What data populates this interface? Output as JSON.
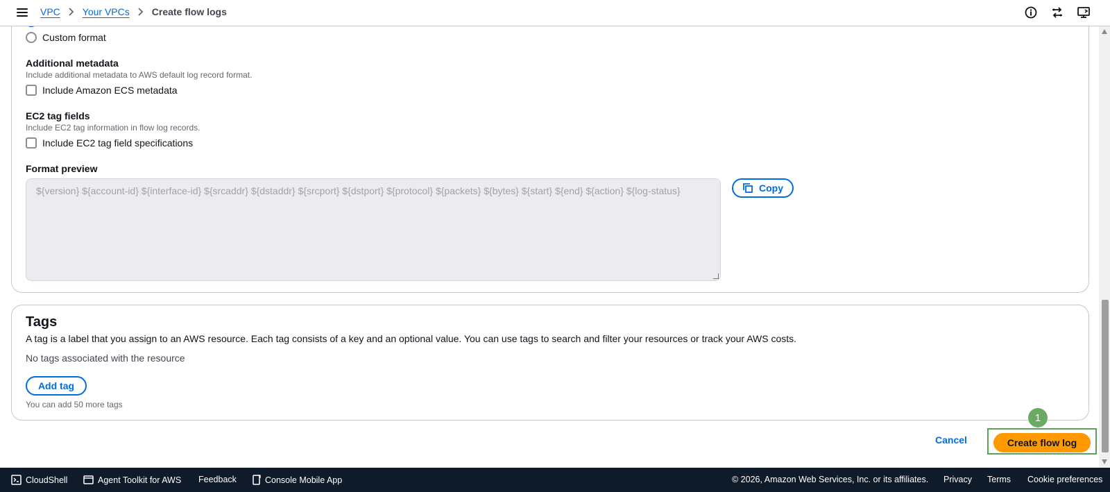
{
  "breadcrumb": {
    "items": [
      "VPC",
      "Your VPCs"
    ],
    "current": "Create flow logs"
  },
  "log_format": {
    "custom_option_label": "Custom format"
  },
  "additional_metadata": {
    "title": "Additional metadata",
    "description": "Include additional metadata to AWS default log record format.",
    "checkbox_label": "Include Amazon ECS metadata"
  },
  "ec2_tags": {
    "title": "EC2 tag fields",
    "description": "Include EC2 tag information in flow log records.",
    "checkbox_label": "Include EC2 tag field specifications"
  },
  "format_preview": {
    "title": "Format preview",
    "text": "${version} ${account-id} ${interface-id} ${srcaddr} ${dstaddr} ${srcport} ${dstport} ${protocol} ${packets} ${bytes} ${start} ${end} ${action} ${log-status}",
    "copy_label": "Copy"
  },
  "tags": {
    "title": "Tags",
    "description": "A tag is a label that you assign to an AWS resource. Each tag consists of a key and an optional value. You can use tags to search and filter your resources or track your AWS costs.",
    "empty_text": "No tags associated with the resource",
    "add_label": "Add tag",
    "hint": "You can add 50 more tags"
  },
  "actions": {
    "cancel_label": "Cancel",
    "create_label": "Create flow log",
    "marker": "1"
  },
  "footer": {
    "cloudshell": "CloudShell",
    "agent_toolkit": "Agent Toolkit for AWS",
    "feedback": "Feedback",
    "mobile_app": "Console Mobile App",
    "copyright": "© 2026, Amazon Web Services, Inc. or its affiliates.",
    "privacy": "Privacy",
    "terms": "Terms",
    "cookies": "Cookie preferences"
  },
  "icons": {
    "menu": "hamburger-icon",
    "info": "info-icon",
    "switch": "switch-icon",
    "console": "console-icon"
  },
  "colors": {
    "link": "#006ce0",
    "primary_button": "#ff9900",
    "footer_bg": "#0f1b2a",
    "highlight": "#5aa35a"
  }
}
